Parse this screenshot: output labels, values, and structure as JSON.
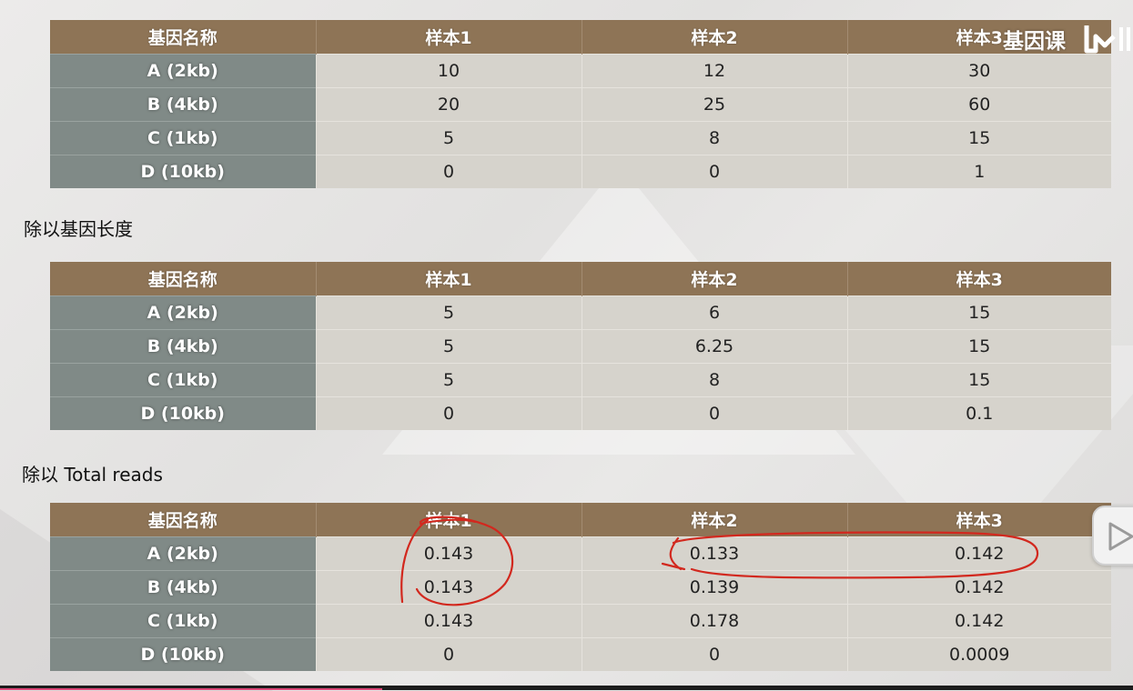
{
  "watermark": "基因课",
  "tables": [
    {
      "header": [
        "基因名称",
        "样本1",
        "样本2",
        "样本3"
      ],
      "rows": [
        [
          "A (2kb)",
          "10",
          "12",
          "30"
        ],
        [
          "B (4kb)",
          "20",
          "25",
          "60"
        ],
        [
          "C (1kb)",
          "5",
          "8",
          "15"
        ],
        [
          "D (10kb)",
          "0",
          "0",
          "1"
        ]
      ]
    },
    {
      "header": [
        "基因名称",
        "样本1",
        "样本2",
        "样本3"
      ],
      "rows": [
        [
          "A (2kb)",
          "5",
          "6",
          "15"
        ],
        [
          "B (4kb)",
          "5",
          "6.25",
          "15"
        ],
        [
          "C (1kb)",
          "5",
          "8",
          "15"
        ],
        [
          "D (10kb)",
          "0",
          "0",
          "0.1"
        ]
      ]
    },
    {
      "header": [
        "基因名称",
        "样本1",
        "样本2",
        "样本3"
      ],
      "rows": [
        [
          "A (2kb)",
          "0.143",
          "0.133",
          "0.142"
        ],
        [
          "B (4kb)",
          "0.143",
          "0.139",
          "0.142"
        ],
        [
          "C (1kb)",
          "0.143",
          "0.178",
          "0.142"
        ],
        [
          "D (10kb)",
          "0",
          "0",
          "0.0009"
        ]
      ]
    }
  ],
  "section_labels": {
    "divide_by_length": "除以基因长度",
    "divide_by_total": "除以 Total reads"
  },
  "icons": {
    "logo": "bilibili-logo-icon",
    "player": "play-icon"
  },
  "colors": {
    "header_bg": "#8e7456",
    "rowhead_bg": "#808a87",
    "cell_bg": "#d6d3cc",
    "annotation": "#d2281e"
  }
}
